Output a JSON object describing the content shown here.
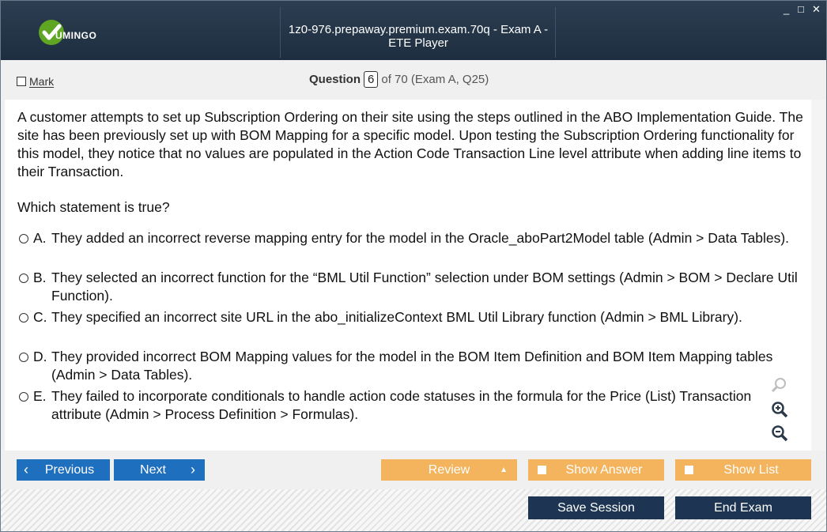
{
  "window": {
    "title": "1z0-976.prepaway.premium.exam.70q - Exam A - ETE Player",
    "logo_text": "UMINGO",
    "minimize": "_",
    "maximize": "□",
    "close": "✕"
  },
  "header": {
    "mark_label": "Mark",
    "question_label": "Question",
    "question_number": "6",
    "question_of": "of 70 (Exam A, Q25)"
  },
  "question": {
    "text": "A customer attempts to set up Subscription Ordering on their site using the steps outlined in the ABO Implementation Guide. The site has been previously set up with BOM Mapping for a specific model. Upon testing the Subscription Ordering functionality for this model, they notice that no values are populated in the Action Code Transaction Line level attribute when adding line items to their Transaction.",
    "prompt": "Which statement is true?",
    "options": [
      {
        "letter": "A.",
        "text": "They added an incorrect reverse mapping entry for the model in the Oracle_aboPart2Model table (Admin > Data Tables)."
      },
      {
        "letter": "B.",
        "text": "They selected an incorrect function for the “BML Util Function” selection under BOM settings (Admin > BOM > Declare Util Function)."
      },
      {
        "letter": "C.",
        "text": "They specified an incorrect site URL in the abo_initializeContext BML Util Library function (Admin > BML Library)."
      },
      {
        "letter": "D.",
        "text": "They provided incorrect BOM Mapping values for the model in the BOM Item Definition and BOM Item Mapping tables (Admin > Data Tables)."
      },
      {
        "letter": "E.",
        "text": "They failed to incorporate conditionals to handle action code statuses in the formula for the Price (List) Transaction attribute (Admin > Process Definition > Formulas)."
      }
    ]
  },
  "nav": {
    "previous": "Previous",
    "next": "Next",
    "review": "Review",
    "show_answer": "Show Answer",
    "show_list": "Show List",
    "save_session": "Save Session",
    "end_exam": "End Exam"
  },
  "colors": {
    "titlebar": "#1e2e40",
    "nav_blue": "#1f6fbf",
    "orange": "#f4b35d",
    "dark_button": "#1d3552",
    "logo_green": "#5fa623"
  }
}
